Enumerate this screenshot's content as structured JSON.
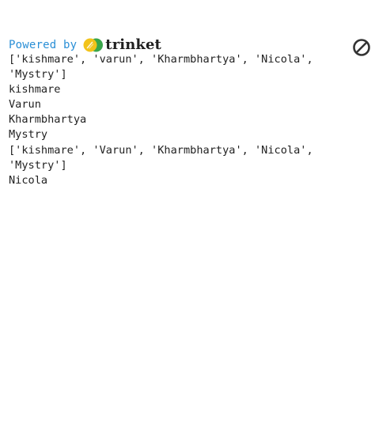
{
  "header": {
    "powered_by": "Powered by",
    "brand": "trinket",
    "brand_colors": {
      "yellow": "#f2c31a",
      "green": "#3aa64b",
      "text": "#1f1f1f"
    },
    "link_color": "#2a8fd6",
    "stop_icon": "block-icon"
  },
  "console": {
    "lines": [
      "['kishmare', 'varun', 'Kharmbhartya', 'Nicola',",
      "'Mystry']",
      "kishmare",
      "Varun",
      "Kharmbhartya",
      "Mystry",
      "['kishmare', 'Varun', 'Kharmbhartya', 'Nicola',",
      "'Mystry']",
      "Nicola"
    ]
  }
}
